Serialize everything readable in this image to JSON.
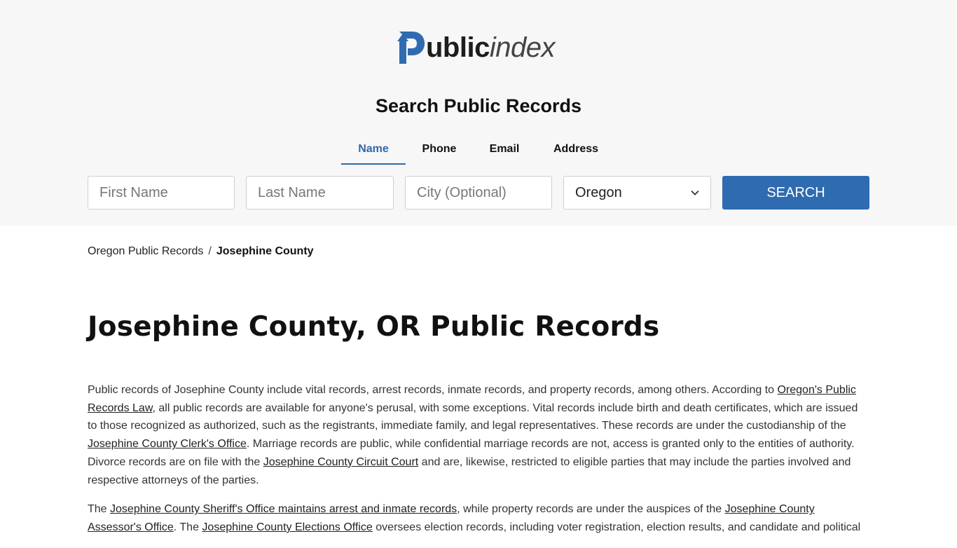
{
  "logo": {
    "text_bold": "ublic",
    "text_light": "index",
    "brand_color": "#2f6bb0"
  },
  "search": {
    "title": "Search Public Records",
    "tabs": [
      {
        "label": "Name",
        "active": true
      },
      {
        "label": "Phone",
        "active": false
      },
      {
        "label": "Email",
        "active": false
      },
      {
        "label": "Address",
        "active": false
      }
    ],
    "first_name_placeholder": "First Name",
    "last_name_placeholder": "Last Name",
    "city_placeholder": "City (Optional)",
    "state_selected": "Oregon",
    "button_label": "SEARCH"
  },
  "breadcrumb": {
    "parent": "Oregon Public Records",
    "separator": "/",
    "current": "Josephine County"
  },
  "page_title": "Josephine County, OR Public Records",
  "paragraphs": [
    {
      "t1": "Public records of Josephine County include vital records, arrest records, inmate records, and property records, among others. According to ",
      "l1": "Oregon's Public Records Law",
      "t2": ", all public records are available for anyone's perusal, with some exceptions. Vital records include birth and death certificates, which are issued to those recognized as authorized, such as the registrants, immediate family, and legal representatives. These records are under the custodianship of the ",
      "l2": "Josephine County Clerk's Office",
      "t3": ". Marriage records are public, while confidential marriage records are not, access is granted only to the entities of authority. Divorce records are on file with the ",
      "l3": "Josephine County Circuit Court",
      "t4": " and are, likewise, restricted to eligible parties that may include the parties involved and respective attorneys of the parties."
    },
    {
      "t1": "The ",
      "l1": "Josephine County Sheriff's Office maintains arrest and inmate records",
      "t2": ", while property records are under the auspices of the ",
      "l2": "Josephine County Assessor's Office",
      "t3": ". The ",
      "l3": "Josephine County Elections Office",
      "t4": " oversees election records, including voter registration, election results, and candidate and political"
    }
  ]
}
